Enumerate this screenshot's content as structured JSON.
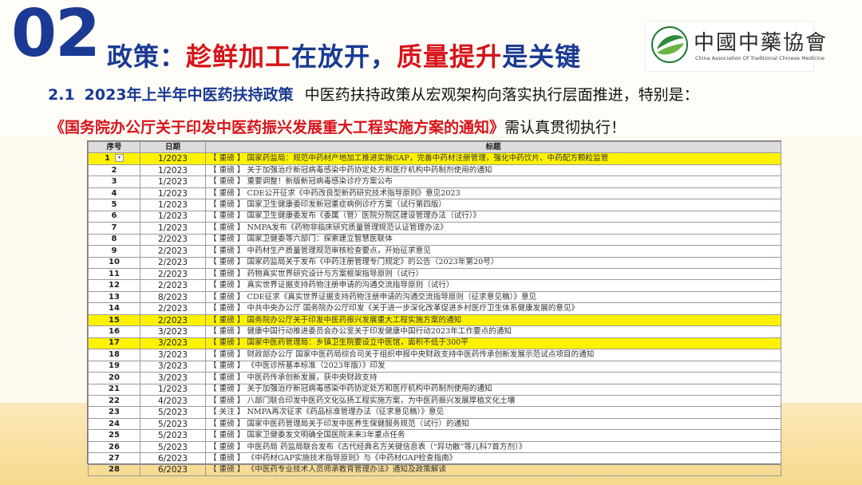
{
  "section_number": "02",
  "headline": {
    "part1": "政策：",
    "part2": "趁鲜加工",
    "part3": "在放开，",
    "part4": "质量提升",
    "part5": "是关键"
  },
  "logo": {
    "cn": "中國中藥協會",
    "en": "China Association Of Traditional Chinese Medicine"
  },
  "subhead": {
    "number": "2.1",
    "title": "2023年上半年中医药扶持政策",
    "desc": "中医药扶持政策从宏观架构向落实执行层面推进，特别是："
  },
  "notice": {
    "highlight": "《国务院办公厅关于印发中医药振兴发展重大工程实施方案的通知》",
    "rest": "需认真贯彻执行！"
  },
  "colors": {
    "navy": "#1a3a93",
    "red": "#d6141b",
    "highlight": "#fff200"
  },
  "table": {
    "headers": [
      "序号",
      "日期",
      "标题"
    ],
    "rows": [
      {
        "no": "1",
        "date": "1/2023",
        "title": "【 重磅 】 国家药监局：规范中药材产地加工推进实施GAP，完善中药材注册管理，强化中药饮片、中药配方颗粒监管",
        "hl": true
      },
      {
        "no": "2",
        "date": "1/2023",
        "title": "【 重磅 】 关于加强治疗新冠病毒感染中药协定处方和医疗机构中药制剂使用的通知",
        "hl": false
      },
      {
        "no": "3",
        "date": "1/2023",
        "title": "【 重磅 】 重要调整！新版新冠病毒感染诊疗方案公布",
        "hl": false
      },
      {
        "no": "4",
        "date": "1/2023",
        "title": "【 重磅 】 CDE公开征求《中药改良型新药研究技术指导原则》意见2023",
        "hl": false
      },
      {
        "no": "5",
        "date": "1/2023",
        "title": "【 重磅 】 国家卫生健康委印发新冠重症病例诊疗方案（试行第四版）",
        "hl": false
      },
      {
        "no": "6",
        "date": "1/2023",
        "title": "【 重磅 】 国家卫生健康委发布《委属（管）医院分院区建设管理办法（试行）》",
        "hl": false
      },
      {
        "no": "7",
        "date": "1/2023",
        "title": "【 重磅 】 NMPA发布《药物非临床研究质量管理规范认证管理办法》",
        "hl": false
      },
      {
        "no": "8",
        "date": "2/2023",
        "title": "【 重磅 】 国家卫健委等六部门：探索建立智慧医联体",
        "hl": false
      },
      {
        "no": "9",
        "date": "2/2023",
        "title": "【 重磅 】 中药材生产质量管理规范审核检查要点，开始征求意见",
        "hl": false
      },
      {
        "no": "10",
        "date": "2/2023",
        "title": "【 重磅 】 国家药监局关于发布《中药注册管理专门规定》的公告（2023年第20号）",
        "hl": false
      },
      {
        "no": "11",
        "date": "2/2023",
        "title": "【 重磅 】 药物真实世界研究设计与方案框架指导原则（试行）",
        "hl": false
      },
      {
        "no": "12",
        "date": "2/2023",
        "title": "【 重磅 】 真实世界证据支持药物注册申请的沟通交流指导原则（试行）",
        "hl": false
      },
      {
        "no": "13",
        "date": "8/2023",
        "title": "【 重磅 】 CDE征求《真实世界证据支持药物注册申请的沟通交流指导原则（征求意见稿）》意见",
        "hl": false
      },
      {
        "no": "14",
        "date": "2/2023",
        "title": "【 重磅 】 中共中央办公厅 国务院办公厅印发《关于进一步深化改革促进乡村医疗卫生体系健康发展的意见》",
        "hl": false
      },
      {
        "no": "15",
        "date": "2/2023",
        "title": "【 重磅 】 国务院办公厅关于印发中医药振兴发展重大工程实施方案的通知",
        "hl": true
      },
      {
        "no": "16",
        "date": "3/2023",
        "title": "【 重磅 】 健康中国行动推进委员会办公室关于印发健康中国行动2023年工作要点的通知",
        "hl": false
      },
      {
        "no": "17",
        "date": "3/2023",
        "title": "【 重磅 】 国家中医药管理局：乡镇卫生院要设立中医馆，面积不低于300平",
        "hl": true
      },
      {
        "no": "18",
        "date": "3/2023",
        "title": "【 重磅 】 财政部办公厅 国家中医药局综合司关于组织申报中央财政支持中医药传承创新发展示范试点项目的通知",
        "hl": false
      },
      {
        "no": "19",
        "date": "3/2023",
        "title": "【 重磅 】 《中医诊所基本标准（2023年版）》印发",
        "hl": false
      },
      {
        "no": "20",
        "date": "3/2023",
        "title": "【 重磅 】 中医药传承创新发展，获中央财政支持",
        "hl": false
      },
      {
        "no": "21",
        "date": "1/2023",
        "title": "【 重磅 】 关于加强治疗新冠病毒感染中药协定处方和医疗机构中药制剂使用的通知",
        "hl": false
      },
      {
        "no": "22",
        "date": "4/2023",
        "title": "【 重磅 】 八部门联合印发中医药文化弘扬工程实施方案，为中医药振兴发展厚植文化土壤",
        "hl": false
      },
      {
        "no": "23",
        "date": "5/2023",
        "title": "【 关注 】 NMPA再次征求《药品标准管理办法（征求意见稿）》意见",
        "hl": false
      },
      {
        "no": "24",
        "date": "5/2023",
        "title": "【 重磅 】 国家中医药管理局关于印发中医养生保健服务规范（试行）的通知",
        "hl": false
      },
      {
        "no": "25",
        "date": "5/2023",
        "title": "【 重磅 】 国家卫健委发文明确全国医院未来3年重点任务",
        "hl": false
      },
      {
        "no": "26",
        "date": "5/2023",
        "title": "【 重磅 】 中医药局 药监局联合发布《古代经典名方关键信息表（“异功散”等儿科7首方剂）》",
        "hl": false
      },
      {
        "no": "27",
        "date": "6/2023",
        "title": "【 重磅 】 《中药材GAP实施技术指导原则》与《中药材GAP检查指南》",
        "hl": false
      },
      {
        "no": "28",
        "date": "6/2023",
        "title": "【 重磅 】 《中医药专业技术人员师承教育管理办法》通知及政策解读",
        "hl": false
      }
    ]
  }
}
